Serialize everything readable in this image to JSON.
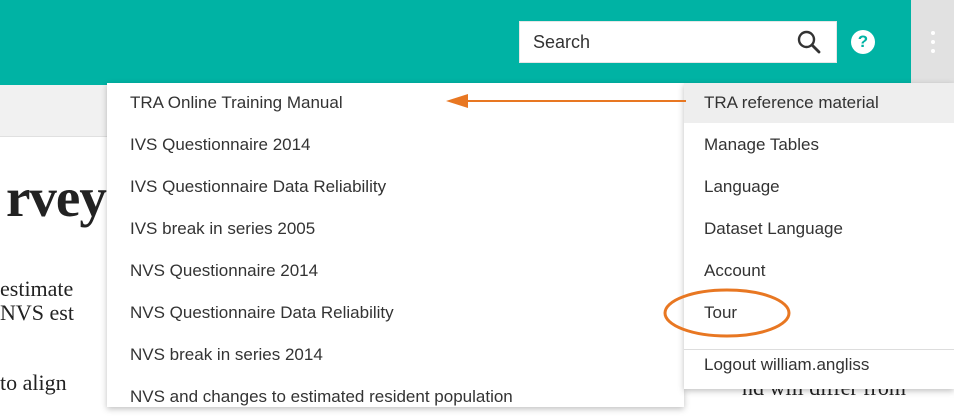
{
  "search": {
    "placeholder": "Search"
  },
  "icons": {
    "search": "search-icon",
    "help": "help-icon",
    "more": "more-vertical-icon"
  },
  "help": {
    "label": "?"
  },
  "colors": {
    "accent": "#00b3a4",
    "annotation": "#e87722",
    "menu_active_bg": "#eeeeee"
  },
  "background": {
    "title": "rvey",
    "lines": [
      "estimate",
      "NVS est",
      "to align",
      "nd will differ from"
    ]
  },
  "submenu": {
    "items": [
      "TRA Online Training Manual",
      "IVS Questionnaire 2014",
      "IVS Questionnaire Data Reliability",
      "IVS break in series 2005",
      "NVS Questionnaire 2014",
      "NVS Questionnaire Data Reliability",
      "NVS break in series 2014",
      "NVS and changes to estimated resident population"
    ]
  },
  "menu": {
    "items": [
      "TRA reference material",
      "Manage Tables",
      "Language",
      "Dataset Language",
      "Account",
      "Tour"
    ],
    "logout": "Logout william.angliss"
  }
}
